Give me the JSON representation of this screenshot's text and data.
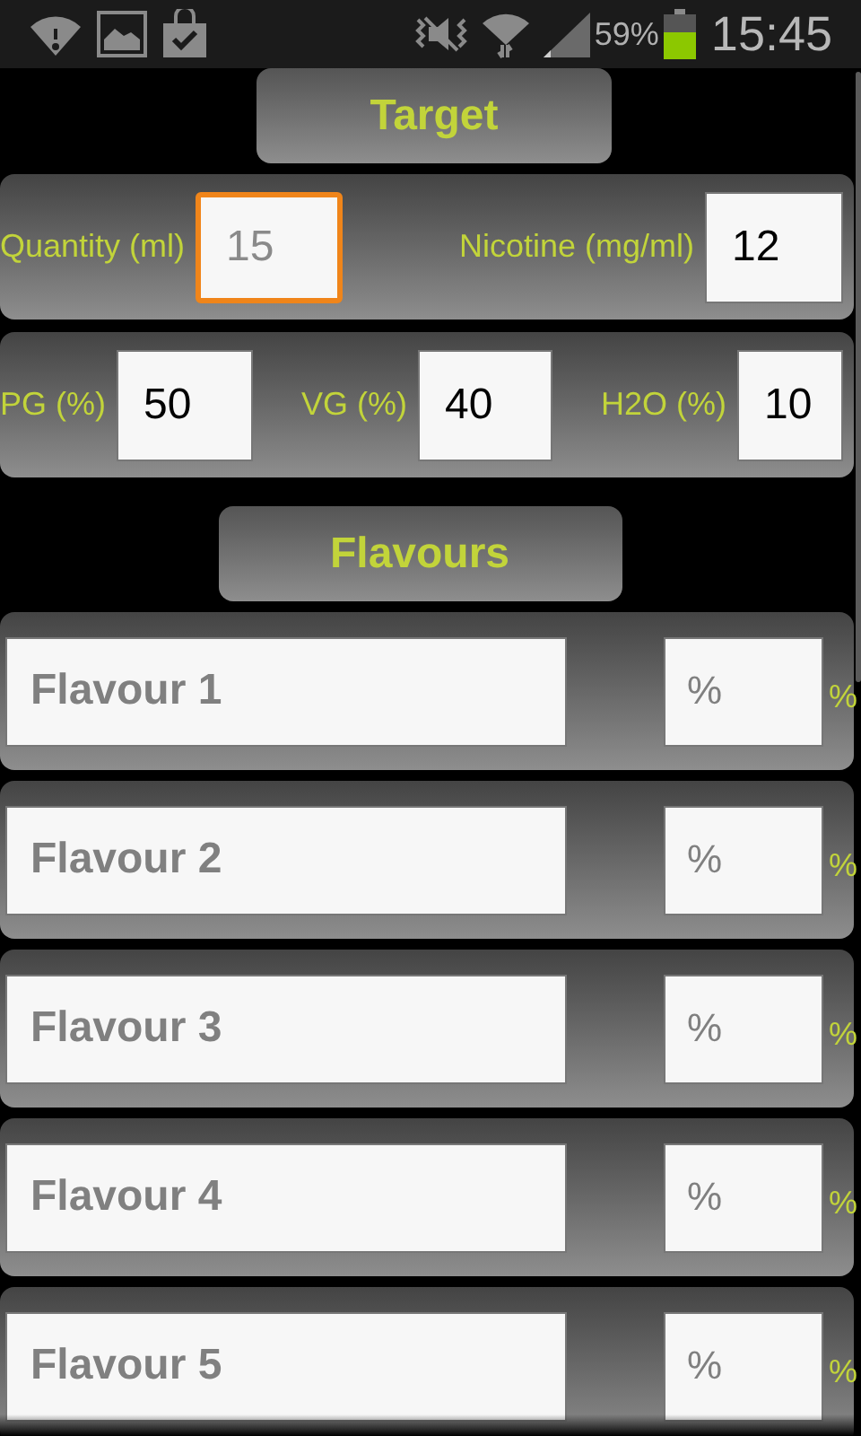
{
  "status_bar": {
    "battery_text": "59%",
    "time": "15:45"
  },
  "target": {
    "title": "Target",
    "rows": [
      {
        "fields": [
          {
            "label": "Quantity (ml)",
            "placeholder": "15",
            "focused": true
          },
          {
            "label": "Nicotine (mg/ml)",
            "value": "12",
            "focused": false
          }
        ]
      },
      {
        "fields": [
          {
            "label": "PG (%)",
            "value": "50",
            "focused": false
          },
          {
            "label": "VG (%)",
            "value": "40",
            "focused": false
          },
          {
            "label": "H2O (%)",
            "value": "10",
            "focused": false
          }
        ]
      }
    ]
  },
  "flavours": {
    "title": "Flavours",
    "items": [
      {
        "name_placeholder": "Flavour 1",
        "percent_placeholder": "%",
        "unit": "%"
      },
      {
        "name_placeholder": "Flavour 2",
        "percent_placeholder": "%",
        "unit": "%"
      },
      {
        "name_placeholder": "Flavour 3",
        "percent_placeholder": "%",
        "unit": "%"
      },
      {
        "name_placeholder": "Flavour 4",
        "percent_placeholder": "%",
        "unit": "%"
      },
      {
        "name_placeholder": "Flavour 5",
        "percent_placeholder": "%",
        "unit": "%"
      }
    ]
  }
}
